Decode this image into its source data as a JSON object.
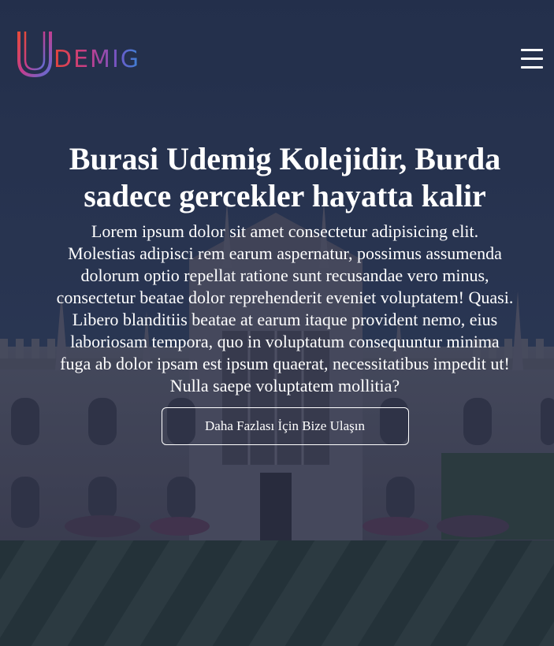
{
  "brand": {
    "logo_letter": "U",
    "logo_rest": "DEMIG",
    "colors": {
      "gradient_start": "#e6453a",
      "gradient_mid": "#c43d8c",
      "gradient_end": "#3a86d6"
    }
  },
  "header": {
    "menu_icon": "hamburger-menu-icon"
  },
  "hero": {
    "title": "Burasi Udemig Kolejidir, Burda sadece gercekler hayatta kalir",
    "text": "Lorem ipsum dolor sit amet consectetur adipisicing elit. Molestias adipisci rem earum aspernatur, possimus assumenda dolorum optio repellat ratione sunt recusandae vero minus, consectetur beatae dolor reprehenderit eveniet voluptatem! Quasi. Libero blanditiis beatae at earum itaque provident nemo, eius laboriosam tempora, quo in voluptatum consequuntur minima fuga ab dolor ipsam est ipsum quaerat, necessitatibus impedit ut! Nulla saepe voluptatem mollitia?",
    "cta_label": "Daha Fazlası İçin Bize Ulaşın"
  },
  "theme": {
    "overlay": "#1c2a4a",
    "text": "#ffffff"
  }
}
